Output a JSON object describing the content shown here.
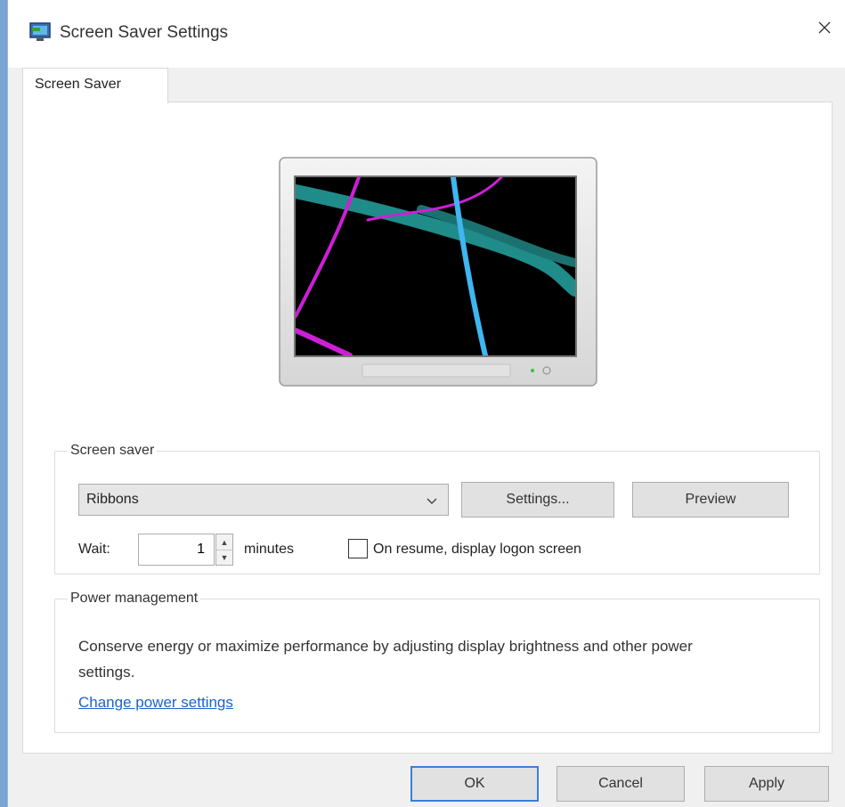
{
  "window": {
    "title": "Screen Saver Settings",
    "tab_label": "Screen Saver"
  },
  "screen_saver": {
    "group_label": "Screen saver",
    "selected": "Ribbons",
    "settings_button": "Settings...",
    "preview_button": "Preview",
    "wait_label": "Wait:",
    "wait_value": "1",
    "minutes_label": "minutes",
    "resume_label": "On resume, display logon screen",
    "resume_checked": false
  },
  "power_management": {
    "group_label": "Power management",
    "description": "Conserve energy or maximize performance by adjusting display brightness and other power settings.",
    "link": "Change power settings"
  },
  "footer": {
    "ok": "OK",
    "cancel": "Cancel",
    "apply": "Apply"
  },
  "colors": {
    "accent": "#3c7fd6",
    "link": "#1a63c9",
    "ribbon_teal": "#1f8c8a",
    "ribbon_magenta": "#cc1fd6",
    "ribbon_cyan": "#3fb6f0"
  }
}
